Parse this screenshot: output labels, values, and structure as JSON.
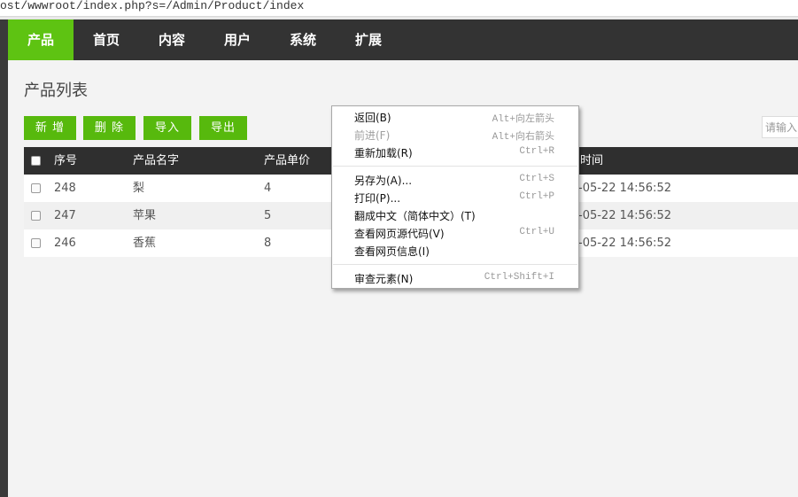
{
  "url": "ost/wwwroot/index.php?s=/Admin/Product/index",
  "nav": {
    "items": [
      {
        "label": "产品"
      },
      {
        "label": "首页"
      },
      {
        "label": "内容"
      },
      {
        "label": "用户"
      },
      {
        "label": "系统"
      },
      {
        "label": "扩展"
      }
    ]
  },
  "page": {
    "title": "产品列表",
    "buttons": {
      "add": "新 增",
      "delete": "删 除",
      "import": "导入",
      "export": "导出"
    },
    "search_placeholder": "请输入"
  },
  "table": {
    "headers": [
      "序号",
      "产品名字",
      "产品单价",
      "时间"
    ],
    "rows": [
      {
        "id": "248",
        "name": "梨",
        "price": "4",
        "time": "-05-22 14:56:52"
      },
      {
        "id": "247",
        "name": "苹果",
        "price": "5",
        "time": "-05-22 14:56:52"
      },
      {
        "id": "246",
        "name": "香蕉",
        "price": "8",
        "time": "-05-22 14:56:52"
      }
    ]
  },
  "context_menu": {
    "items": [
      {
        "label": "返回(B)",
        "shortcut": "Alt+向左箭头",
        "disabled": false
      },
      {
        "label": "前进(F)",
        "shortcut": "Alt+向右箭头",
        "disabled": true
      },
      {
        "label": "重新加载(R)",
        "shortcut": "Ctrl+R",
        "disabled": false
      },
      {
        "label": "另存为(A)...",
        "shortcut": "Ctrl+S",
        "disabled": false
      },
      {
        "label": "打印(P)...",
        "shortcut": "Ctrl+P",
        "disabled": false
      },
      {
        "label": "翻成中文（简体中文）(T)",
        "shortcut": "",
        "disabled": false
      },
      {
        "label": "查看网页源代码(V)",
        "shortcut": "Ctrl+U",
        "disabled": false
      },
      {
        "label": "查看网页信息(I)",
        "shortcut": "",
        "disabled": false
      },
      {
        "label": "审查元素(N)",
        "shortcut": "Ctrl+Shift+I",
        "disabled": false
      }
    ]
  },
  "colors": {
    "nav_bg": "#333333",
    "accent": "#5ec312",
    "button": "#57b90d",
    "table_header": "#2f2f2f"
  }
}
